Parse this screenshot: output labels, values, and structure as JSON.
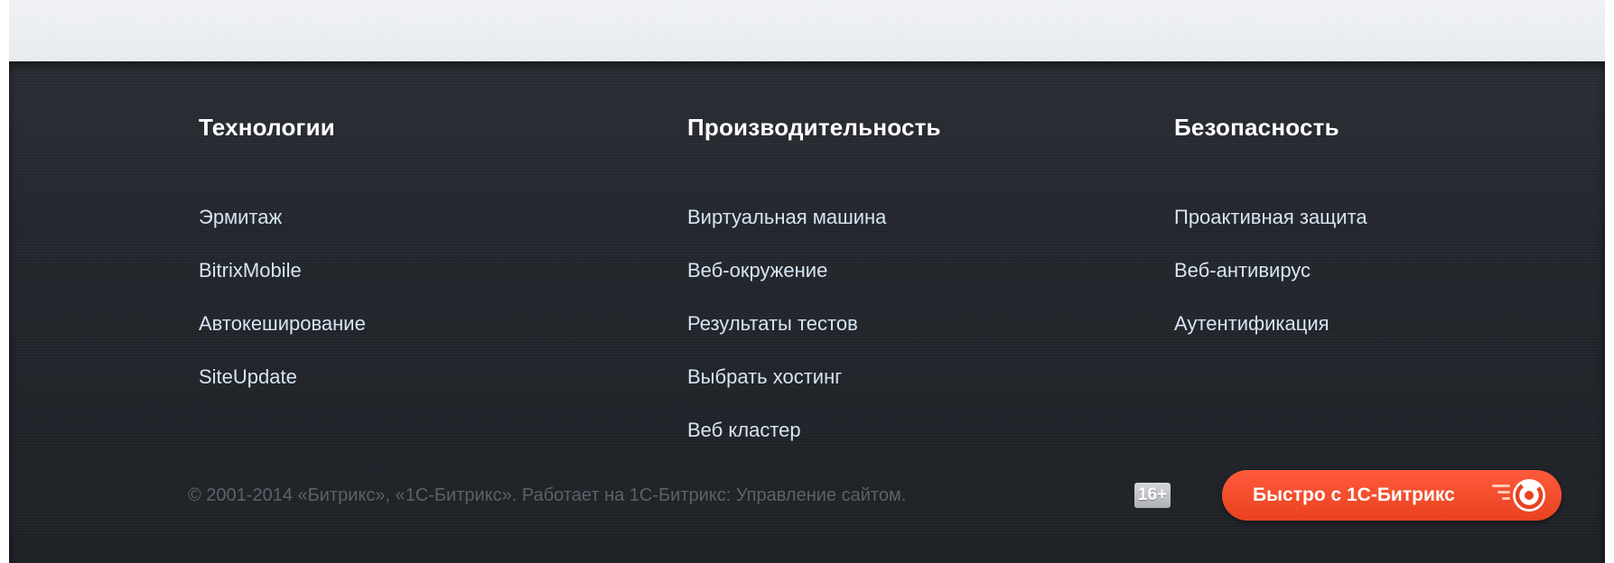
{
  "footer": {
    "columns": [
      {
        "title": "Технологии",
        "links": [
          "Эрмитаж",
          "BitrixMobile",
          "Автокеширование",
          "SiteUpdate"
        ]
      },
      {
        "title": "Производительность",
        "links": [
          "Виртуальная машина",
          "Веб-окружение",
          "Результаты тестов",
          "Выбрать хостинг",
          "Веб кластер"
        ]
      },
      {
        "title": "Безопасность",
        "links": [
          "Проактивная защита",
          "Веб-антивирус",
          "Аутентификация"
        ]
      }
    ],
    "copyright": "© 2001-2014 «Битрикс», «1С-Битрикс». Работает на 1С-Битрикс: Управление сайтом.",
    "age_rating": "16+",
    "bitrix_button_label": "Быстро с 1С-Битрикс"
  },
  "colors": {
    "footer_background": "#23262c",
    "link": "#d6e4f3",
    "heading": "#ffffff",
    "copyright": "#5d6168",
    "button_accent": "#e8421f"
  },
  "icons": {
    "bitrix_logo": "bitrix-logo-icon",
    "speed_lines": "speed-lines-icon"
  }
}
